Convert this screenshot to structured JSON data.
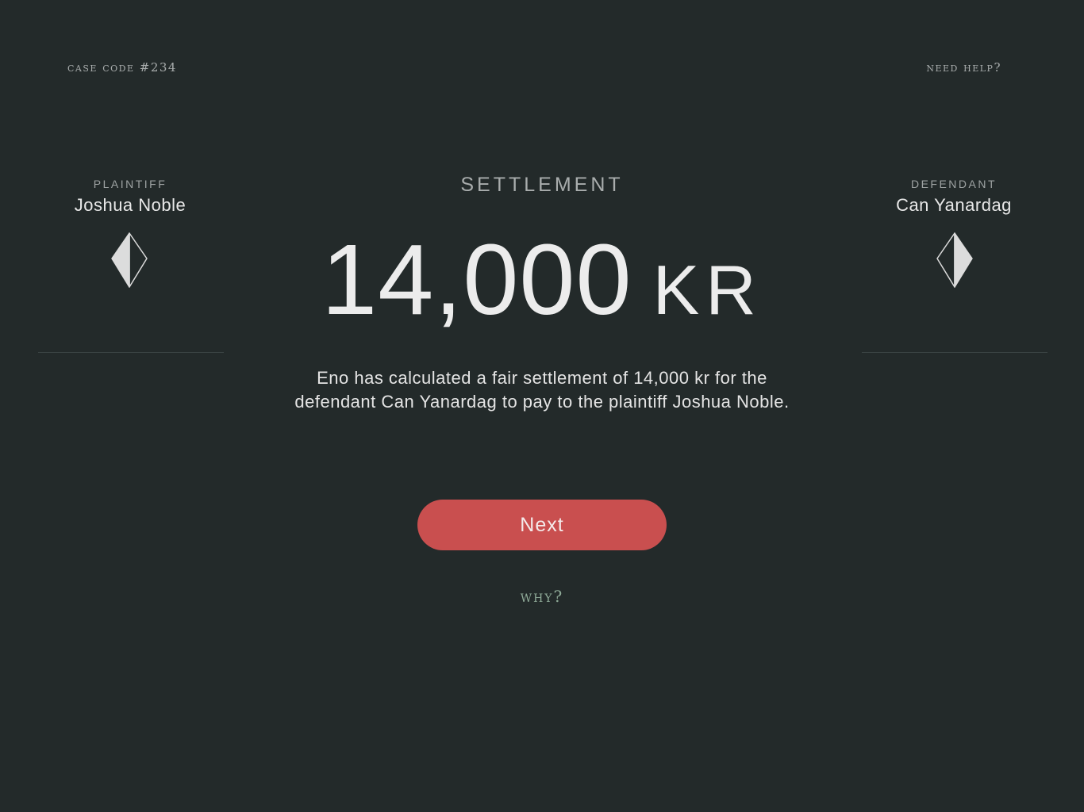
{
  "header": {
    "case_code": "CASE CODE #234",
    "help_link": "NEED HELP?"
  },
  "plaintiff": {
    "role": "PLAINTIFF",
    "name": "Joshua Noble"
  },
  "defendant": {
    "role": "DEFENDANT",
    "name": "Can Yanardag"
  },
  "settlement": {
    "label": "SETTLEMENT",
    "amount": "14,000",
    "currency": "KR",
    "description_line1": "Eno has calculated a fair settlement of 14,000 kr for the",
    "description_line2": "defendant Can Yanardag to pay to the plaintiff Joshua Noble."
  },
  "actions": {
    "next_label": "Next",
    "why_label": "WHY?"
  },
  "colors": {
    "background": "#232a2a",
    "accent_button": "#c94f4f",
    "why_link": "#8faa98"
  },
  "icons": {
    "plaintiff": "shield-left-icon",
    "defendant": "shield-right-icon"
  }
}
